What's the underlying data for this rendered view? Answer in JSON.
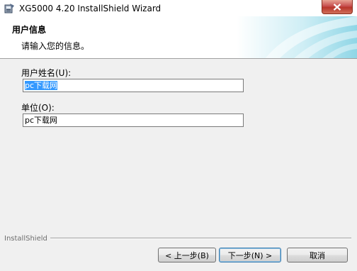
{
  "window": {
    "title": "XG5000 4.20 InstallShield Wizard"
  },
  "banner": {
    "title": "用户信息",
    "subtitle": "请输入您的信息。"
  },
  "form": {
    "username_label": "用户姓名(U):",
    "username_value": "pc下载网",
    "company_label": "单位(O):",
    "company_value": "pc下载网"
  },
  "footer": {
    "brand": "InstallShield",
    "back_label": "< 上一步(B)",
    "next_label": "下一步(N) >",
    "cancel_label": "取消"
  },
  "icons": {
    "app": "installer-icon",
    "close": "close-icon"
  },
  "colors": {
    "selection": "#3399ff",
    "close_button": "#c75050",
    "default_button_border": "#3c7fb1"
  }
}
